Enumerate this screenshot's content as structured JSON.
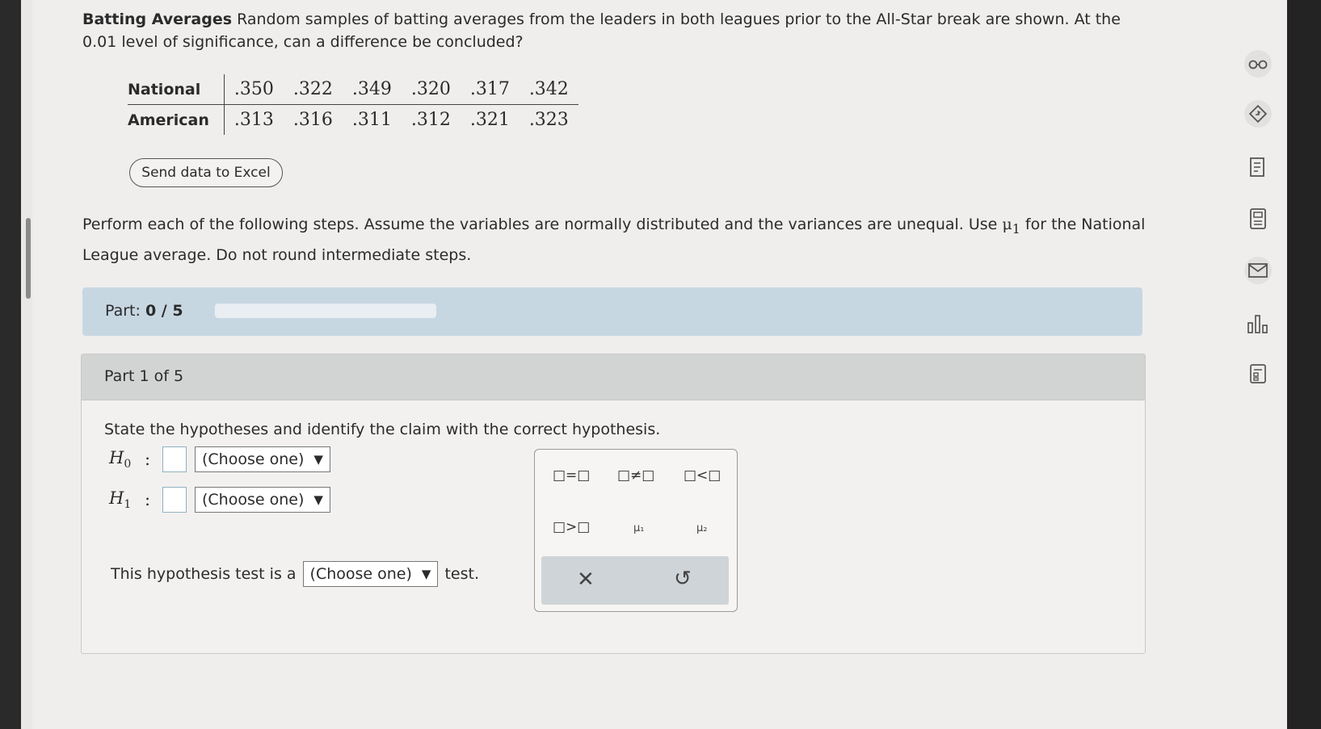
{
  "intro": {
    "title": "Batting Averages",
    "text": "Random samples of batting averages from the leaders in both leagues prior to the All-Star break are shown. At the 0.01 level of significance, can a difference be concluded?"
  },
  "table": {
    "rows": [
      {
        "label": "National",
        "values": [
          ".350",
          ".322",
          ".349",
          ".320",
          ".317",
          ".342"
        ]
      },
      {
        "label": "American",
        "values": [
          ".313",
          ".316",
          ".311",
          ".312",
          ".321",
          ".323"
        ]
      }
    ]
  },
  "excel_button": "Send data to Excel",
  "instructions": {
    "before": "Perform each of the following steps. Assume the variables are normally distributed and the variances are unequal. Use",
    "mu_symbol": "μ",
    "mu_sub": "1",
    "after": "for the National League average. Do not round intermediate steps."
  },
  "progress": {
    "label": "Part:",
    "value": "0 / 5",
    "fraction": 0
  },
  "part_header": "Part 1 of 5",
  "question": "State the hypotheses and identify the claim with the correct hypothesis.",
  "hypotheses": {
    "h0": {
      "letter": "H",
      "sub": "0",
      "colon": ":",
      "select": "(Choose one)"
    },
    "h1": {
      "letter": "H",
      "sub": "1",
      "colon": ":",
      "select": "(Choose one)"
    }
  },
  "test_row": {
    "prefix": "This hypothesis test is a",
    "select": "(Choose one)",
    "suffix": "test."
  },
  "dropdown_arrow": "▼",
  "palette": {
    "eq": "□=□",
    "neq": "□≠□",
    "lt": "□<□",
    "gt": "□>□",
    "mu1": "μ₁",
    "mu2": "μ₂",
    "clear": "✕",
    "undo": "↺"
  },
  "rail_icons": [
    "glasses-icon",
    "navigate-icon",
    "notebook-icon",
    "calculator-icon",
    "mail-icon",
    "chart-icon",
    "notes-icon"
  ]
}
